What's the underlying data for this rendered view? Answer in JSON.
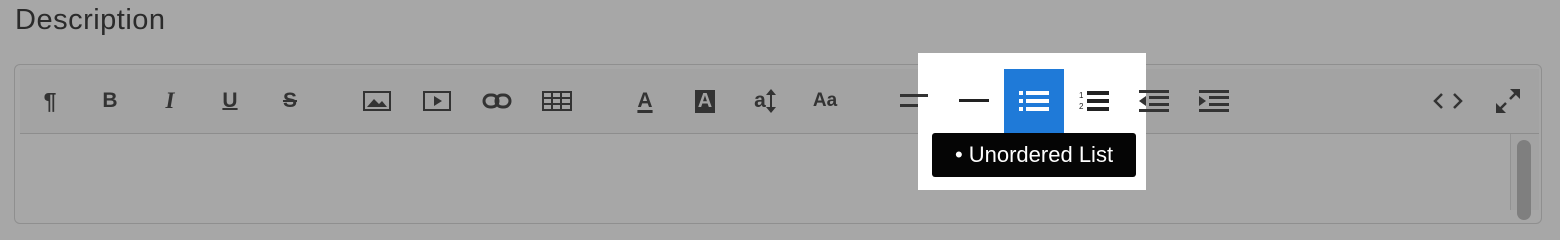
{
  "section": {
    "title": "Description"
  },
  "toolbar": {
    "buttons": [
      {
        "name": "paragraph-button",
        "icon": "paragraph-icon",
        "glyph": "¶"
      },
      {
        "name": "bold-button",
        "icon": "bold-icon",
        "glyph": "B"
      },
      {
        "name": "italic-button",
        "icon": "italic-icon",
        "glyph": "I"
      },
      {
        "name": "underline-button",
        "icon": "underline-icon",
        "glyph": "U"
      },
      {
        "name": "strikethrough-button",
        "icon": "strikethrough-icon",
        "glyph": "S"
      },
      {
        "name": "insert-image-button",
        "icon": "image-icon"
      },
      {
        "name": "insert-video-button",
        "icon": "video-icon"
      },
      {
        "name": "insert-link-button",
        "icon": "link-icon"
      },
      {
        "name": "insert-table-button",
        "icon": "table-icon"
      },
      {
        "name": "text-color-button",
        "icon": "text-color-icon",
        "glyph": "A"
      },
      {
        "name": "background-color-button",
        "icon": "background-color-icon",
        "glyph": "A"
      },
      {
        "name": "line-height-button",
        "icon": "line-height-icon",
        "glyph": "a"
      },
      {
        "name": "font-size-button",
        "icon": "font-size-icon",
        "glyph": "Aa"
      },
      {
        "name": "align-button",
        "icon": "align-left-icon"
      },
      {
        "name": "horizontal-rule-button",
        "icon": "horizontal-rule-icon"
      },
      {
        "name": "unordered-list-button",
        "icon": "unordered-list-icon",
        "active": true
      },
      {
        "name": "ordered-list-button",
        "icon": "ordered-list-icon"
      },
      {
        "name": "outdent-button",
        "icon": "outdent-icon"
      },
      {
        "name": "indent-button",
        "icon": "indent-icon"
      },
      {
        "name": "code-view-button",
        "icon": "code-icon"
      },
      {
        "name": "fullscreen-button",
        "icon": "expand-icon"
      }
    ],
    "tooltip": "• Unordered List"
  },
  "colors": {
    "overlay": "#a7a7a7",
    "active": "#1f7ad8",
    "tooltip_bg": "#050505",
    "icon": "#333333"
  }
}
